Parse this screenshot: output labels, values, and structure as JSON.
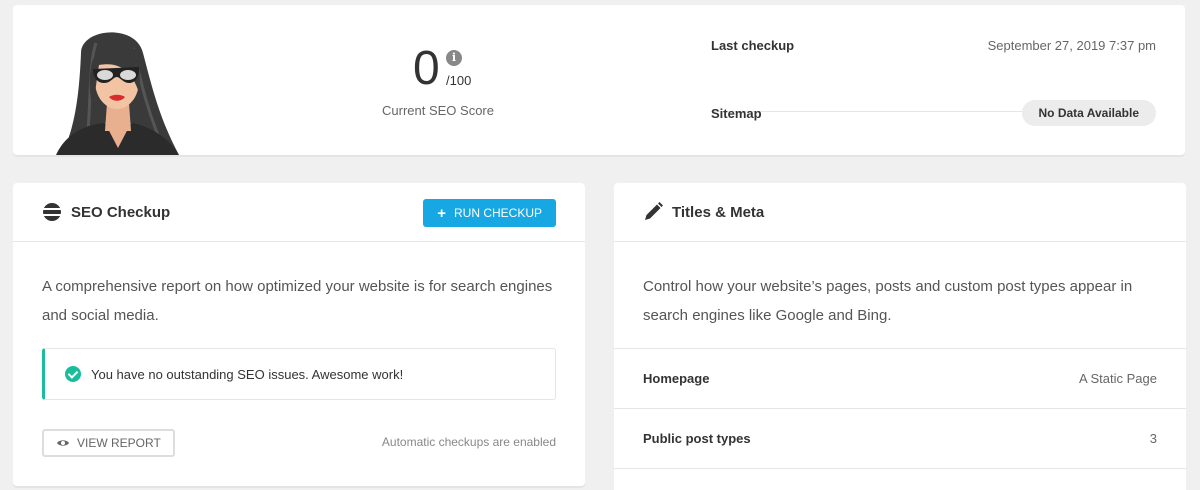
{
  "summary": {
    "score_value": "0",
    "score_max": "/100",
    "score_label": "Current SEO Score",
    "last_checkup_label": "Last checkup",
    "last_checkup_value": "September 27, 2019 7:37 pm",
    "sitemap_label": "Sitemap",
    "sitemap_value": "No Data Available"
  },
  "seo_checkup": {
    "title": "SEO Checkup",
    "run_button": "RUN CHECKUP",
    "description": "A comprehensive report on how optimized your website is for search engines and social media.",
    "notice": "You have no outstanding SEO issues. Awesome work!",
    "view_report": "VIEW REPORT",
    "auto_note": "Automatic checkups are enabled"
  },
  "titles_meta": {
    "title": "Titles & Meta",
    "description": "Control how your website’s pages, posts and custom post types appear in search engines like Google and Bing.",
    "rows": [
      {
        "label": "Homepage",
        "value": "A Static Page"
      },
      {
        "label": "Public post types",
        "value": "3"
      }
    ]
  },
  "colors": {
    "accent": "#17a8e3",
    "success": "#1abc9c"
  }
}
